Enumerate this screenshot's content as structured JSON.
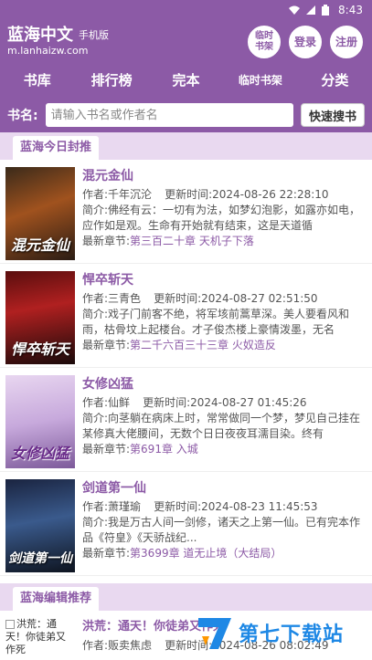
{
  "status": {
    "time": "8:43"
  },
  "header": {
    "brand": "蓝海中文",
    "brand_sub": "手机版",
    "domain": "m.lanhaizw.com",
    "btn_bookshelf": "临时书架",
    "btn_login": "登录",
    "btn_register": "注册"
  },
  "nav": {
    "items": [
      "书库",
      "排行榜",
      "完本",
      "临时书架",
      "分类"
    ]
  },
  "search": {
    "label": "书名:",
    "placeholder": "请输入书名或作者名",
    "button": "快速搜书"
  },
  "sections": {
    "featured": "蓝海今日封推",
    "editor": "蓝海编辑推荐"
  },
  "labels": {
    "author": "作者:",
    "updated": "更新时间:",
    "intro": "简介:",
    "latest": "最新章节:"
  },
  "books": [
    {
      "title": "混元金仙",
      "author": "千年沉沦",
      "updated": "2024-08-26 22:28:10",
      "intro": "佛经有云：一切有为法，如梦幻泡影，如露亦如电，应作如是观。生命有开始就有结束，这是天道循",
      "latest": "第三百二十章 天机子下落",
      "cover_text": "混元金仙"
    },
    {
      "title": "悍卒斩天",
      "author": "三青色",
      "updated": "2024-08-27 02:51:50",
      "intro": "戏子门前客不绝，将军垓前蒿草深。美人要看风和雨，枯骨坟上起楼台。才子俊杰楼上豪情泼墨，无名",
      "latest": "第二千六百三十三章 火奴造反",
      "cover_text": "悍卒斩天"
    },
    {
      "title": "女修凶猛",
      "author": "仙鲜",
      "updated": "2024-08-27 01:45:26",
      "intro": "向茎躺在病床上时，常常做同一个梦，梦见自己挂在某修真大佬腰间，无数个日日夜夜耳濡目染。终有",
      "latest": "第691章 入城",
      "cover_text": "女修凶猛"
    },
    {
      "title": "剑道第一仙",
      "author": "萧瑾瑜",
      "updated": "2024-08-23 11:45:53",
      "intro": "我是万古人间一剑修，诸天之上第一仙。已有完本作品《符皇》《天骄战纪...",
      "latest": "第3699章 道无止境（大结局）",
      "cover_text": "剑道第一仙"
    }
  ],
  "editor_book": {
    "cover_alt": "洪荒：通天！你徒弟又作死",
    "title": "洪荒：通天！你徒弟又作死",
    "author": "贩卖焦虑",
    "updated": "2024-08-26 08:02:49"
  },
  "watermark": {
    "text": "第七下载站"
  },
  "colors": {
    "brand": "#8c5aa6",
    "section_bg": "#e9d9f0"
  }
}
